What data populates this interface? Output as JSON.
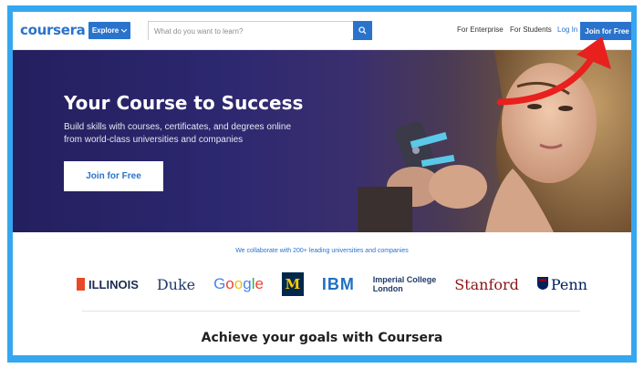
{
  "header": {
    "logo": "coursera",
    "explore_label": "Explore",
    "search_placeholder": "What do you want to learn?",
    "for_enterprise": "For Enterprise",
    "for_students": "For Students",
    "login": "Log In",
    "join_label": "Join for Free"
  },
  "hero": {
    "title": "Your Course to Success",
    "subtitle": "Build skills with courses, certificates, and degrees online from world-class universities and companies",
    "cta": "Join for Free"
  },
  "partners": {
    "intro": "We collaborate with 200+ leading universities and companies",
    "items": {
      "illinois": "ILLINOIS",
      "duke": "Duke",
      "google": "Google",
      "michigan": "M",
      "ibm": "IBM",
      "imperial_line1": "Imperial College",
      "imperial_line2": "London",
      "stanford": "Stanford",
      "penn": "Penn"
    }
  },
  "section": {
    "goals_title": "Achieve your goals with Coursera"
  },
  "colors": {
    "frame": "#35a7f0",
    "brand_blue": "#2a73cc",
    "hero_bg": "#2d2870",
    "annotation_arrow": "#e8201e"
  },
  "icons": {
    "explore_chevron": "chevron-down-icon",
    "search": "search-icon",
    "annotation": "red-curved-arrow-icon"
  }
}
